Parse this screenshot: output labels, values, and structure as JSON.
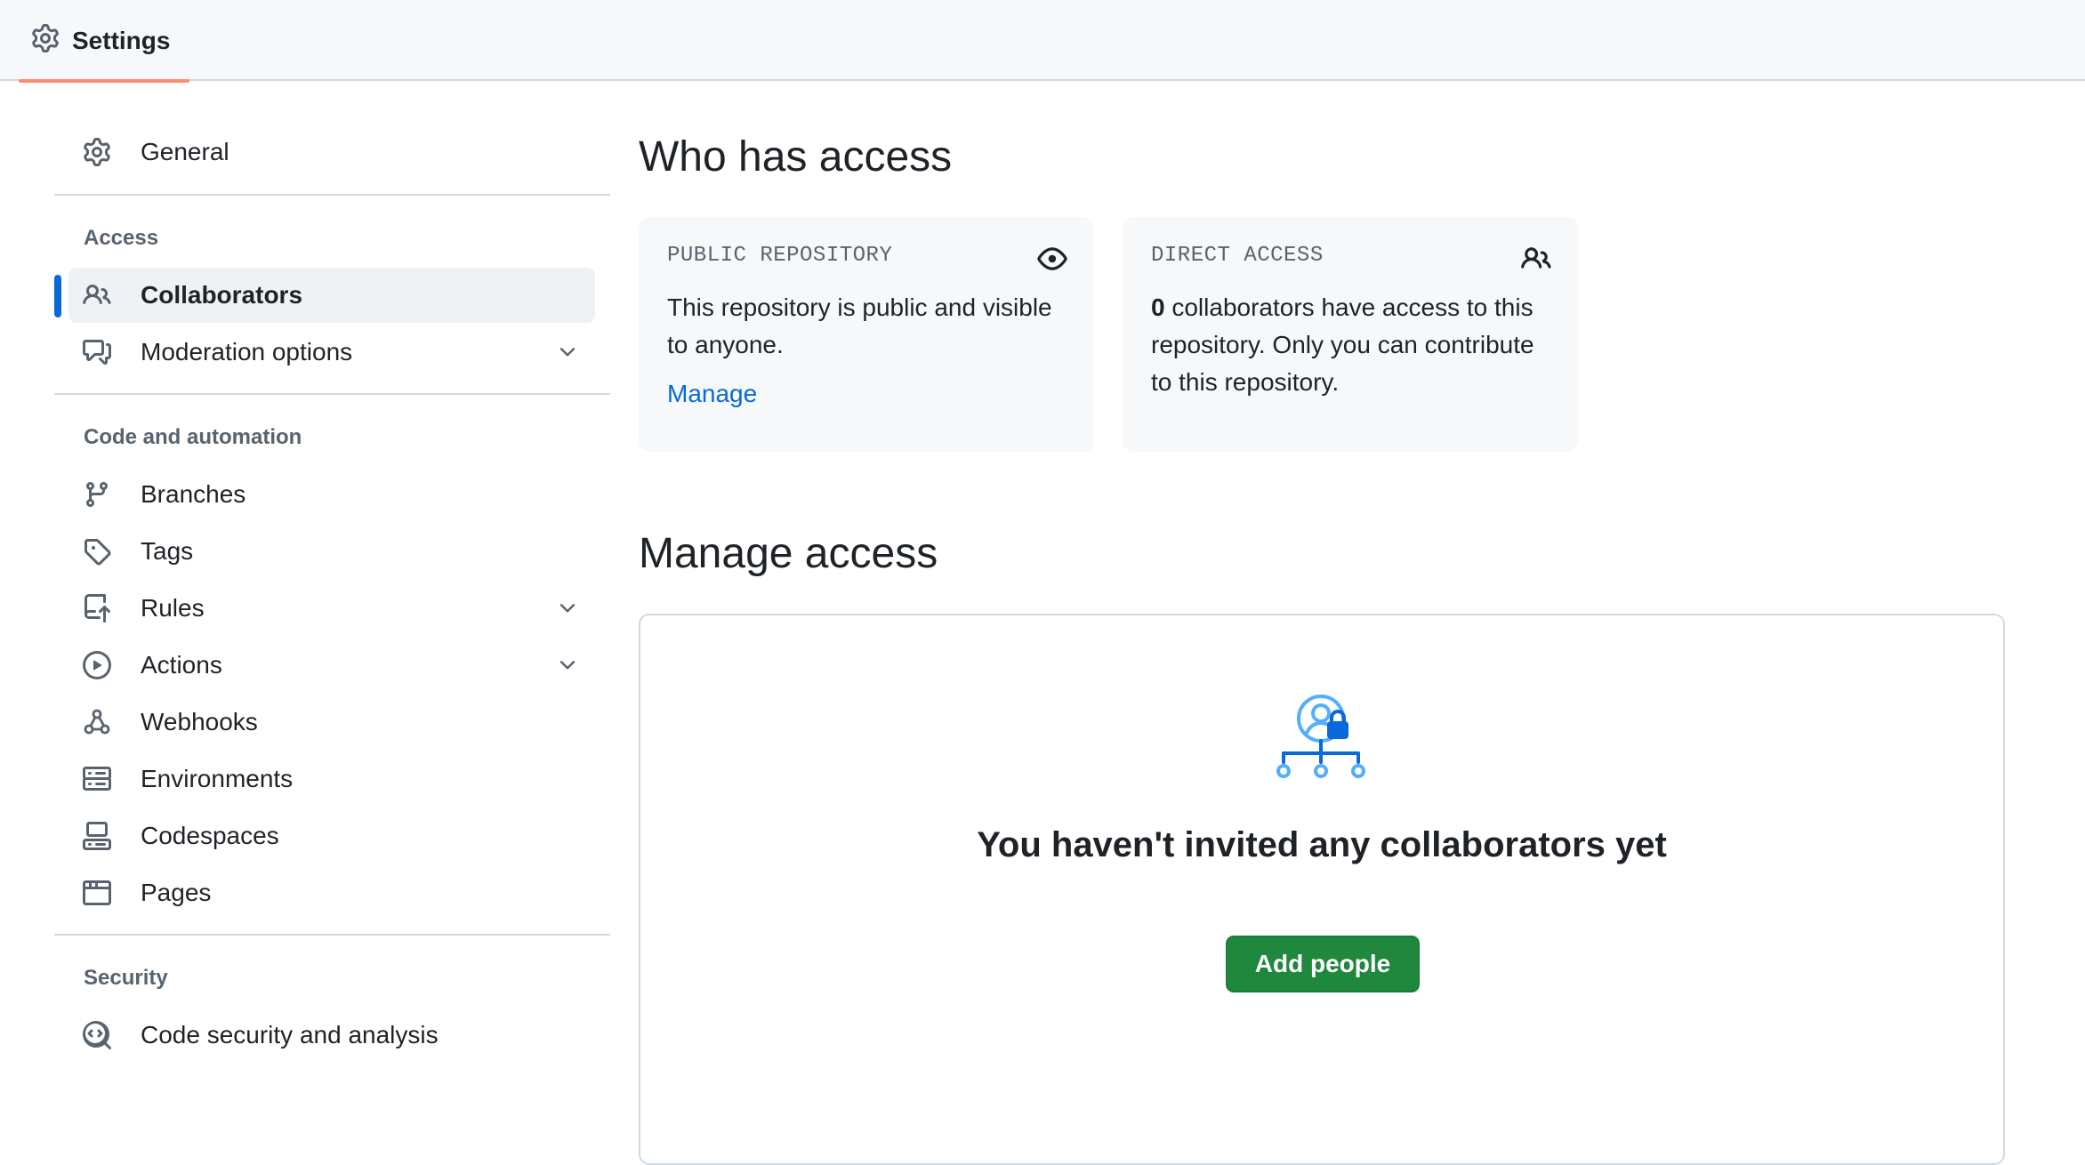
{
  "header": {
    "tab_label": "Settings",
    "tab_icon": "gear-icon"
  },
  "sidebar": {
    "general": {
      "label": "General",
      "icon": "gear-icon"
    },
    "groups": [
      {
        "heading": "Access"
      },
      {
        "heading": "Code and automation"
      },
      {
        "heading": "Security"
      }
    ],
    "items": {
      "collaborators": {
        "label": "Collaborators",
        "icon": "people-icon",
        "active": true
      },
      "moderation": {
        "label": "Moderation options",
        "icon": "comment-discussion-icon"
      },
      "branches": {
        "label": "Branches",
        "icon": "git-branch-icon"
      },
      "tags": {
        "label": "Tags",
        "icon": "tag-icon"
      },
      "rules": {
        "label": "Rules",
        "icon": "repo-push-icon"
      },
      "actions": {
        "label": "Actions",
        "icon": "play-icon"
      },
      "webhooks": {
        "label": "Webhooks",
        "icon": "webhook-icon"
      },
      "environments": {
        "label": "Environments",
        "icon": "server-icon"
      },
      "codespaces": {
        "label": "Codespaces",
        "icon": "codespaces-icon"
      },
      "pages": {
        "label": "Pages",
        "icon": "browser-icon"
      },
      "code_security": {
        "label": "Code security and analysis",
        "icon": "codescan-icon"
      }
    }
  },
  "main": {
    "who_has_access": {
      "title": "Who has access",
      "public_card": {
        "heading": "PUBLIC REPOSITORY",
        "icon": "eye-icon",
        "text": "This repository is public and visible to anyone.",
        "link": "Manage"
      },
      "direct_card": {
        "heading": "DIRECT ACCESS",
        "icon": "people-icon",
        "count": "0",
        "text": " collaborators have access to this repository. Only you can contribute to this repository."
      }
    },
    "manage_access": {
      "title": "Manage access",
      "empty_title": "You haven't invited any collaborators yet",
      "add_button": "Add people"
    }
  },
  "colors": {
    "accent_blue": "#0969da",
    "primary_green": "#1f883d",
    "tab_underline": "#fd8c73",
    "muted_text": "#59636e",
    "border": "#d1d9e0"
  }
}
